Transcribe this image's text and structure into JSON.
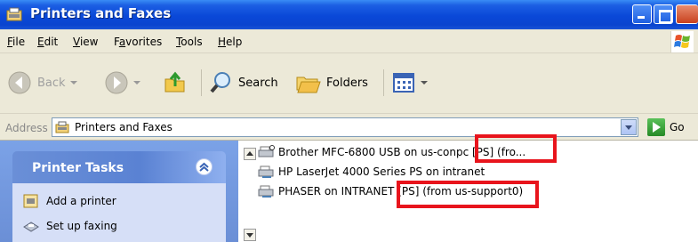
{
  "window": {
    "title": "Printers and Faxes"
  },
  "menu": {
    "items": [
      {
        "label": "File",
        "mnemonic": "F",
        "rest": "ile"
      },
      {
        "label": "Edit",
        "mnemonic": "E",
        "rest": "dit"
      },
      {
        "label": "View",
        "mnemonic": "V",
        "rest": "iew"
      },
      {
        "label": "Favorites",
        "pre": "F",
        "mnemonic": "a",
        "rest": "vorites"
      },
      {
        "label": "Tools",
        "mnemonic": "T",
        "rest": "ools"
      },
      {
        "label": "Help",
        "mnemonic": "H",
        "rest": "elp"
      }
    ]
  },
  "toolbar": {
    "back_label": "Back",
    "search_label": "Search",
    "folders_label": "Folders"
  },
  "address": {
    "label": "Address",
    "value": "Printers and Faxes",
    "go_label": "Go"
  },
  "taskpane": {
    "title": "Printer Tasks",
    "links": [
      "Add a printer",
      "Set up faxing"
    ]
  },
  "printers": [
    "Brother MFC-6800 USB on us-conpc [PS] (fro...",
    "HP LaserJet 4000 Series PS on intranet",
    "PHASER on INTRANET [PS] (from us-support0)"
  ],
  "colors": {
    "title_bar": "#0a48d8",
    "highlight": "#e8141c",
    "taskpane": "#6b8fd6"
  }
}
